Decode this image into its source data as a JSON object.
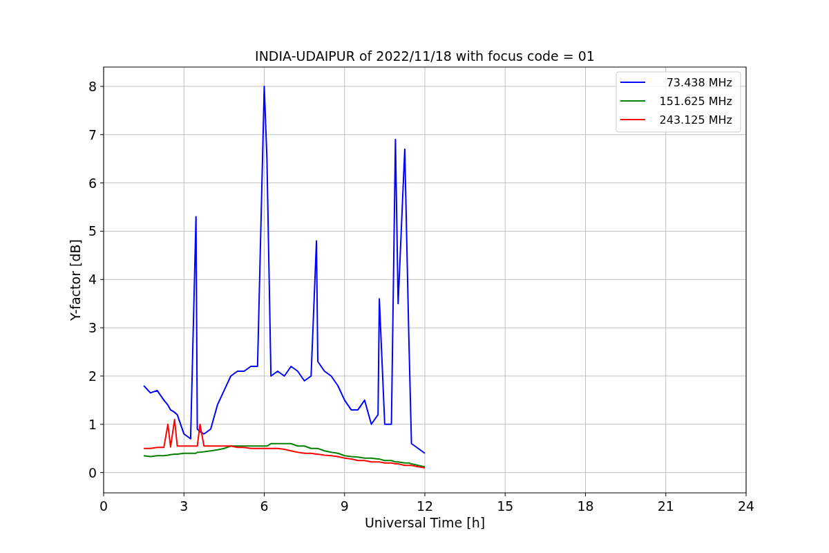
{
  "figure": {
    "chart_data": {
      "type": "line",
      "title": "INDIA-UDAIPUR of 2022/11/18 with focus code = 01",
      "xlabel": "Universal Time [h]",
      "ylabel": "Y-factor [dB]",
      "x": [
        1.5,
        1.75,
        2,
        2.25,
        2.4,
        2.5,
        2.65,
        2.75,
        3,
        3.25,
        3.45,
        3.5,
        3.6,
        3.75,
        4,
        4.25,
        4.5,
        4.75,
        5,
        5.25,
        5.5,
        5.75,
        6,
        6.1,
        6.25,
        6.5,
        6.75,
        7,
        7.25,
        7.5,
        7.75,
        7.95,
        8,
        8.25,
        8.5,
        8.75,
        9,
        9.25,
        9.5,
        9.75,
        10,
        10.25,
        10.3,
        10.5,
        10.75,
        10.9,
        11,
        11.25,
        11.4,
        11.5,
        11.75,
        12
      ],
      "series": [
        {
          "name": "73.438 MHz",
          "color": "#0000ff",
          "values": [
            1.8,
            1.65,
            1.7,
            1.5,
            1.4,
            1.3,
            1.25,
            1.2,
            0.8,
            0.7,
            5.3,
            0.9,
            0.85,
            0.8,
            0.9,
            1.4,
            1.7,
            2.0,
            2.1,
            2.1,
            2.2,
            2.2,
            8.0,
            6.5,
            2.0,
            2.1,
            2.0,
            2.2,
            2.1,
            1.9,
            2.0,
            4.8,
            2.3,
            2.1,
            2.0,
            1.8,
            1.5,
            1.3,
            1.3,
            1.5,
            1.0,
            1.2,
            3.6,
            1.0,
            1.0,
            6.9,
            3.5,
            6.7,
            2.8,
            0.6,
            0.5,
            0.4
          ]
        },
        {
          "name": "151.625 MHz",
          "color": "#008000",
          "values": [
            0.35,
            0.33,
            0.35,
            0.35,
            0.36,
            0.37,
            0.38,
            0.38,
            0.4,
            0.4,
            0.4,
            0.42,
            0.42,
            0.43,
            0.45,
            0.47,
            0.5,
            0.55,
            0.55,
            0.55,
            0.55,
            0.55,
            0.55,
            0.55,
            0.6,
            0.6,
            0.6,
            0.6,
            0.55,
            0.55,
            0.5,
            0.5,
            0.5,
            0.45,
            0.42,
            0.4,
            0.35,
            0.33,
            0.32,
            0.3,
            0.3,
            0.28,
            0.28,
            0.25,
            0.25,
            0.22,
            0.22,
            0.2,
            0.2,
            0.18,
            0.15,
            0.12
          ]
        },
        {
          "name": "243.125 MHz",
          "color": "#ff0000",
          "values": [
            0.5,
            0.5,
            0.52,
            0.52,
            1.0,
            0.53,
            1.1,
            0.55,
            0.55,
            0.55,
            0.55,
            0.55,
            1.0,
            0.55,
            0.55,
            0.55,
            0.55,
            0.55,
            0.52,
            0.52,
            0.5,
            0.5,
            0.5,
            0.5,
            0.5,
            0.5,
            0.48,
            0.45,
            0.42,
            0.4,
            0.4,
            0.38,
            0.38,
            0.36,
            0.35,
            0.33,
            0.3,
            0.28,
            0.25,
            0.25,
            0.22,
            0.22,
            0.22,
            0.2,
            0.2,
            0.18,
            0.18,
            0.15,
            0.15,
            0.15,
            0.12,
            0.1
          ]
        }
      ],
      "grid": true,
      "legend": true,
      "xlim": [
        0,
        24
      ],
      "ylim": [
        -0.42,
        8.4
      ],
      "xticks": [
        0,
        3,
        6,
        9,
        12,
        15,
        18,
        21,
        24
      ],
      "yticks": [
        0,
        1,
        2,
        3,
        4,
        5,
        6,
        7,
        8
      ]
    }
  }
}
